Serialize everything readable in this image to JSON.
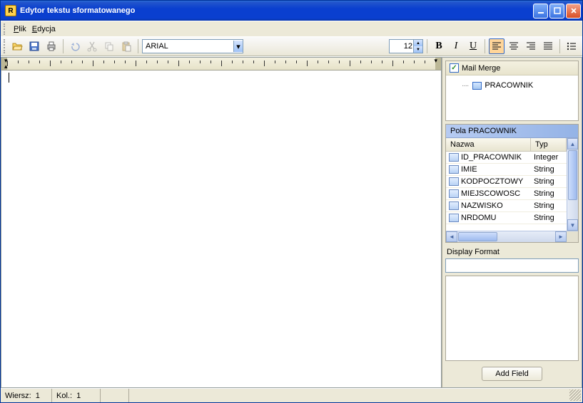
{
  "window": {
    "title": "Edytor tekstu sformatowanego"
  },
  "menubar": {
    "file": "Plik",
    "file_accel": "P",
    "edit": "Edycja",
    "edit_accel": "E"
  },
  "toolbar": {
    "font_name": "ARIAL",
    "font_size": "12",
    "bold": "B",
    "italic": "I",
    "underline": "U"
  },
  "mail_merge": {
    "label": "Mail Merge",
    "checked": true,
    "root": "PRACOWNIK"
  },
  "fields_panel": {
    "title": "Pola PRACOWNIK",
    "columns": {
      "name": "Nazwa",
      "type": "Typ"
    },
    "rows": [
      {
        "name": "ID_PRACOWNIK",
        "type": "Integer"
      },
      {
        "name": "IMIE",
        "type": "String"
      },
      {
        "name": "KODPOCZTOWY",
        "type": "String"
      },
      {
        "name": "MIEJSCOWOSC",
        "type": "String"
      },
      {
        "name": "NAZWISKO",
        "type": "String"
      },
      {
        "name": "NRDOMU",
        "type": "String"
      }
    ]
  },
  "display_format": {
    "label": "Display Format",
    "value": ""
  },
  "add_field": {
    "label": "Add Field"
  },
  "status": {
    "row_label": "Wiersz:",
    "row_value": "1",
    "col_label": "Kol.:",
    "col_value": "1"
  }
}
